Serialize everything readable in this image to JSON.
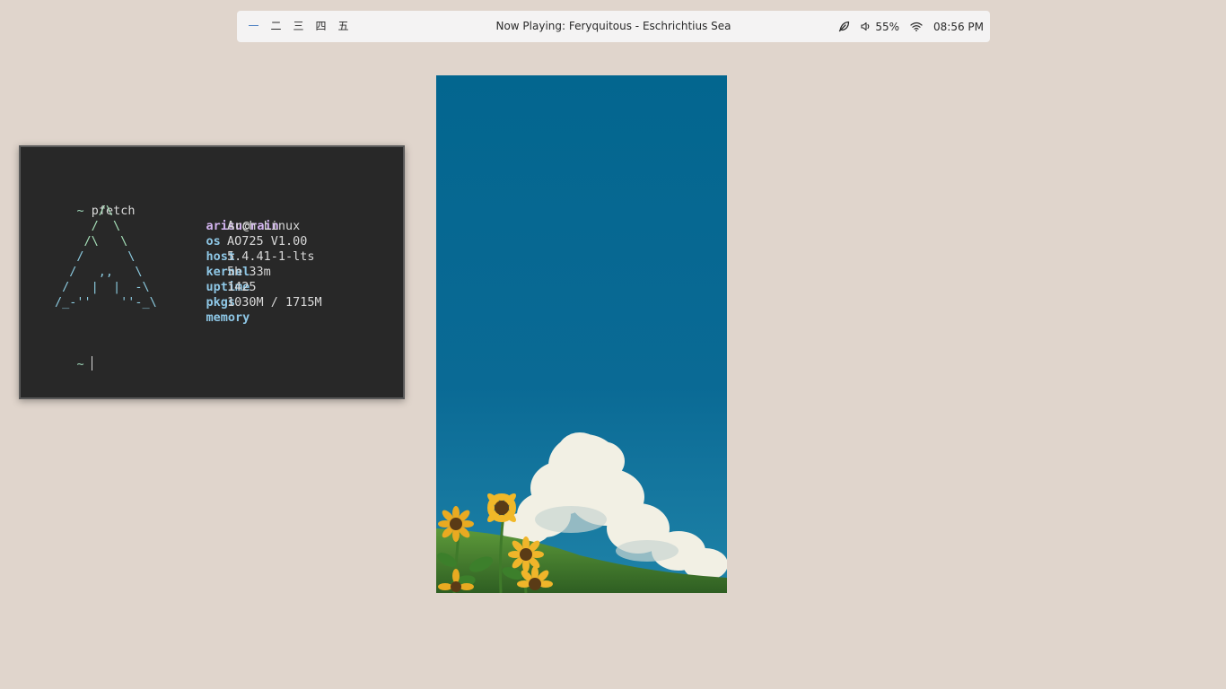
{
  "topbar": {
    "workspaces": [
      "一",
      "二",
      "三",
      "四",
      "五"
    ],
    "active_workspace": 0,
    "now_playing": "Now Playing: Feryquitous - Eschrichtius Sea",
    "status": {
      "leaf_icon": "leaf-icon",
      "volume_icon": "volume-icon",
      "volume": "55%",
      "wifi_icon": "wifi-icon",
      "time": "08:56 PM"
    },
    "accent_color": "#4a7fc1"
  },
  "terminal": {
    "prompt_symbol": "~",
    "command": "pfetch",
    "ascii_art": [
      "      /\\",
      "     /  \\",
      "    /\\   \\",
      "   /      \\",
      "  /   ,,   \\",
      " /   |  |  -\\",
      "/_-''    ''-_\\"
    ],
    "user": "arisu",
    "at": "@",
    "host": "rain",
    "info": [
      {
        "key": "os",
        "value": "Arch Linux"
      },
      {
        "key": "host",
        "value": "AO725 V1.00"
      },
      {
        "key": "kernel",
        "value": "5.4.41-1-lts"
      },
      {
        "key": "uptime",
        "value": "5h 33m"
      },
      {
        "key": "pkgs",
        "value": "1425"
      },
      {
        "key": "memory",
        "value": "1030M / 1715M"
      }
    ],
    "second_prompt": "~"
  },
  "wallpaper": {
    "description_icon": "wallpaper-image"
  }
}
